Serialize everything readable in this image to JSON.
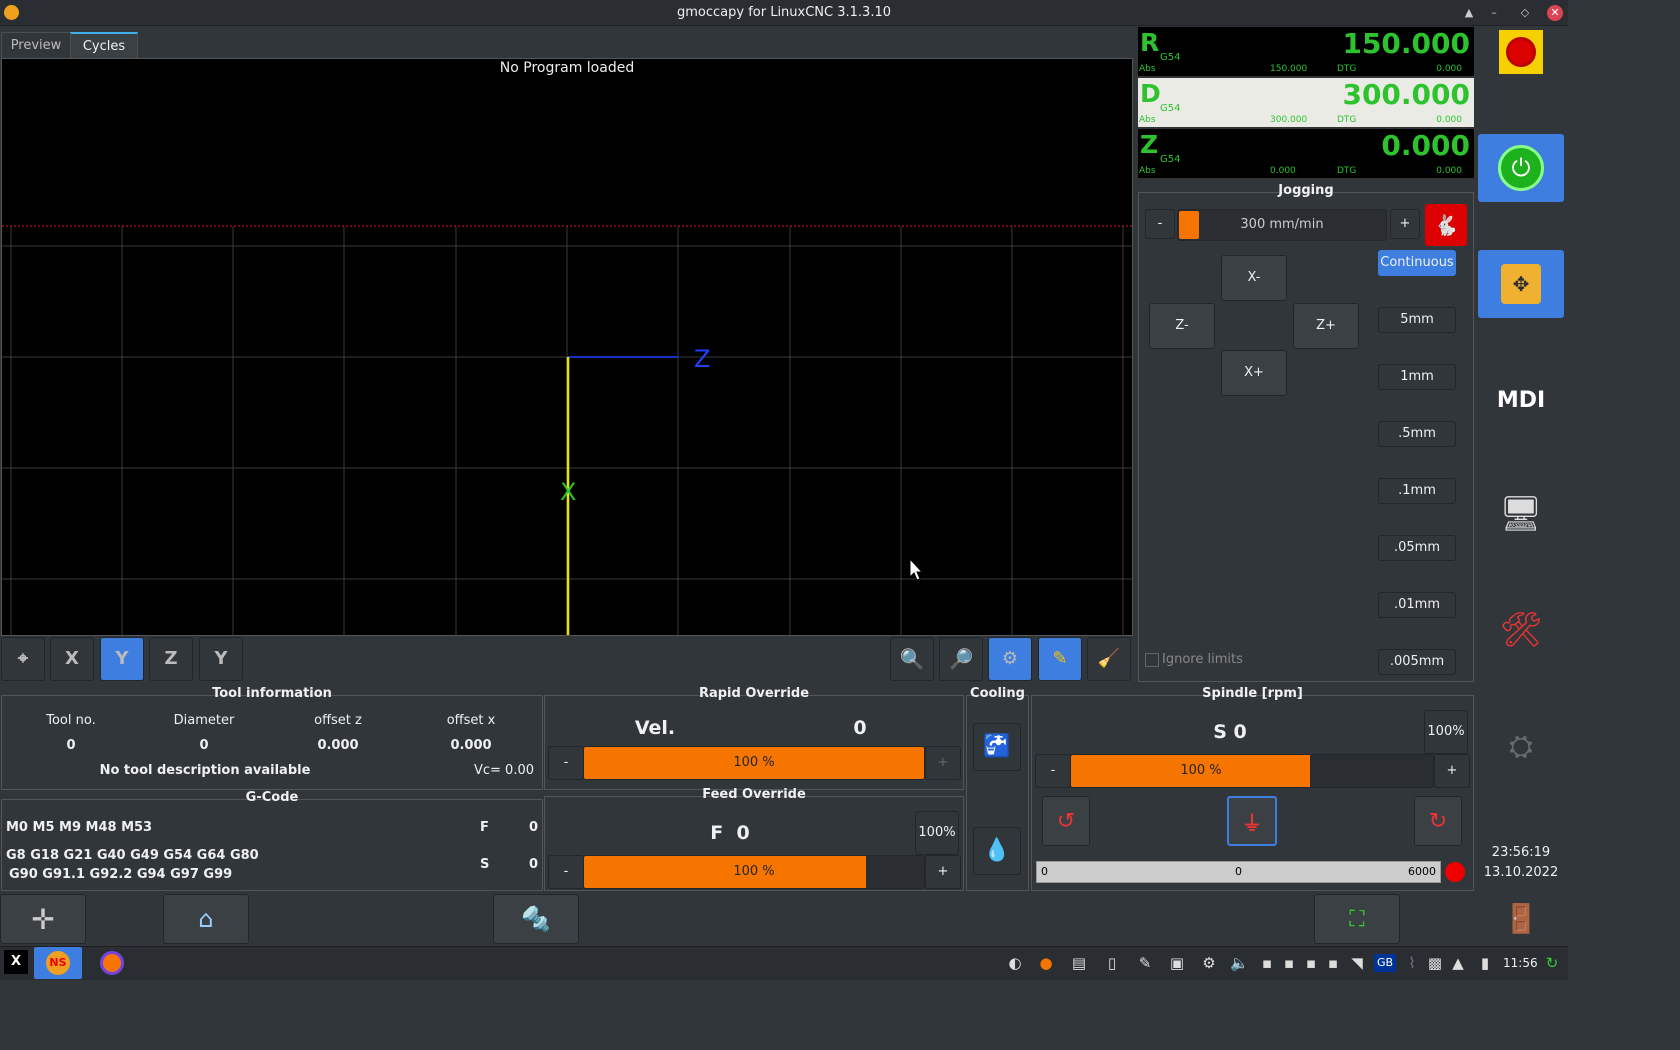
{
  "window": {
    "title": "gmoccapy for LinuxCNC 3.1.3.10"
  },
  "tabs": [
    {
      "label": "Preview"
    },
    {
      "label": "Cycles"
    }
  ],
  "preview": {
    "status": "No Program loaded",
    "axis_z": "Z",
    "axis_x": "X"
  },
  "view_buttons": [
    "P",
    "X",
    "Y",
    "Z",
    "Y2"
  ],
  "dro": [
    {
      "axis": "R",
      "coord": "G54",
      "value": "150.000",
      "abs_label": "Abs",
      "abs": "150.000",
      "dtg_label": "DTG",
      "dtg": "0.000"
    },
    {
      "axis": "D",
      "coord": "G54",
      "value": "300.000",
      "abs_label": "Abs",
      "abs": "300.000",
      "dtg_label": "DTG",
      "dtg": "0.000"
    },
    {
      "axis": "Z",
      "coord": "G54",
      "value": "0.000",
      "abs_label": "Abs",
      "abs": "0.000",
      "dtg_label": "DTG",
      "dtg": "0.000"
    }
  ],
  "jogging": {
    "title": "Jogging",
    "minus": "-",
    "plus": "+",
    "speed": "300 mm/min",
    "speed_fraction": 0.08,
    "mode": "Continuous",
    "buttons": {
      "x_minus": "X-",
      "x_plus": "X+",
      "z_minus": "Z-",
      "z_plus": "Z+"
    },
    "increments": [
      "5mm",
      "1mm",
      ".5mm",
      ".1mm",
      ".05mm",
      ".01mm",
      ".005mm"
    ],
    "ignore_limits": "Ignore limits"
  },
  "tool_info": {
    "title": "Tool information",
    "headers": [
      "Tool no.",
      "Diameter",
      "offset z",
      "offset x"
    ],
    "values": [
      "0",
      "0",
      "0.000",
      "0.000"
    ],
    "description": "No tool description available",
    "vc": "Vc= 0.00"
  },
  "gcode": {
    "title": "G-Code",
    "mcodes": "M0 M5 M9 M48 M53",
    "gcodes_line1": "G8 G18 G21 G40 G49 G54 G64 G80",
    "gcodes_line2": "G90 G91.1 G92.2 G94 G97 G99",
    "f_label": "F",
    "f_value": "0",
    "s_label": "S",
    "s_value": "0"
  },
  "rapid_override": {
    "title": "Rapid Override",
    "vel_label": "Vel.",
    "vel_value": "0",
    "percent": "100 %",
    "fraction": 1.0,
    "minus": "-",
    "plus": "+"
  },
  "feed_override": {
    "title": "Feed Override",
    "value": "F  0",
    "reset": "100%",
    "percent": "100 %",
    "fraction": 0.83,
    "minus": "-",
    "plus": "+"
  },
  "cooling": {
    "title": "Cooling"
  },
  "spindle": {
    "title": "Spindle [rpm]",
    "value": "S 0",
    "reset": "100%",
    "percent": "100 %",
    "fraction": 0.66,
    "minus": "-",
    "plus": "+",
    "scale_min": "0",
    "scale_mid": "0",
    "scale_max": "6000"
  },
  "clock": {
    "time": "23:56:19",
    "date": "13.10.2022"
  },
  "taskbar": {
    "time": "11:56"
  },
  "colors": {
    "accent": "#3d7ee0",
    "dro_green": "#2ec32e",
    "override": "#f67400"
  }
}
